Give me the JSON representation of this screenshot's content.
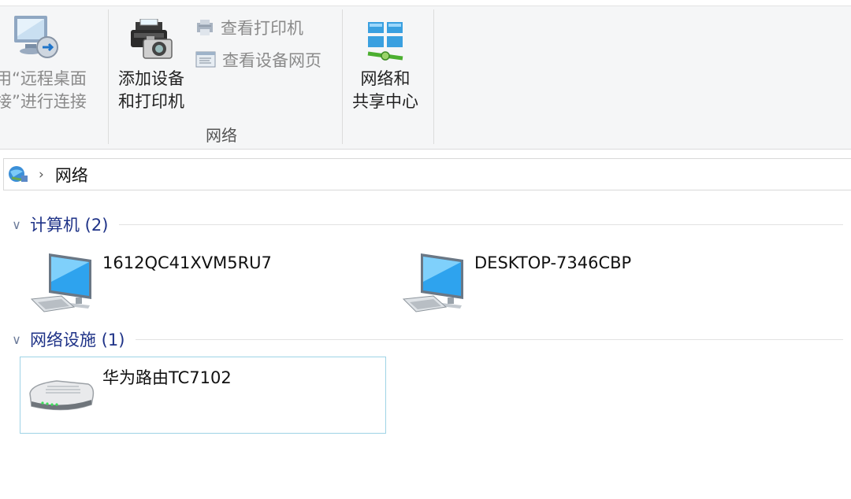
{
  "ribbon": {
    "remote_desktop_label_1": "用“远程桌面",
    "remote_desktop_label_2": "接”进行连接",
    "add_devices_label_1": "添加设备",
    "add_devices_label_2": "和打印机",
    "view_printers_label": "查看打印机",
    "view_device_webpage_label": "查看设备网页",
    "network_center_label_1": "网络和",
    "network_center_label_2": "共享中心",
    "group_network_label": "网络"
  },
  "address_bar": {
    "crumb": "网络"
  },
  "groups": [
    {
      "title": "计算机 (2)"
    },
    {
      "title": "网络设施 (1)"
    }
  ],
  "computers": [
    {
      "name": "1612QC41XVM5RU7",
      "icon": "computer-icon"
    },
    {
      "name": "DESKTOP-7346CBP",
      "icon": "computer-icon"
    }
  ],
  "infrastructure": [
    {
      "name": "华为路由TC7102",
      "icon": "router-icon"
    }
  ],
  "colors": {
    "group_title": "#1e3287",
    "selection_border": "#9fd3e6",
    "ribbon_bg": "#f5f6f7"
  }
}
